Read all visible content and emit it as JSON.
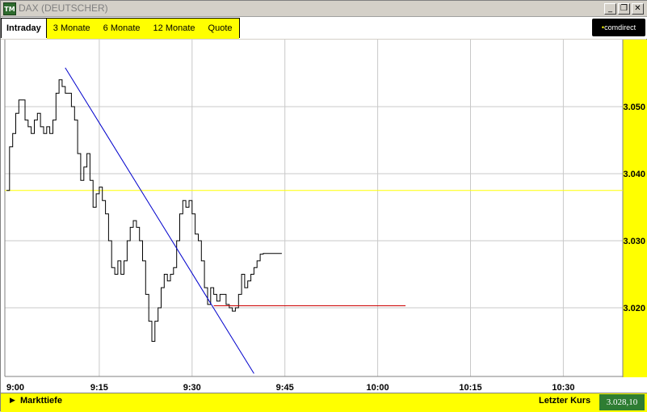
{
  "window": {
    "title": "DAX (DEUTSCHER)",
    "icon_text": "TM",
    "buttons": {
      "minimize": "_",
      "restore": "❐",
      "close": "✕"
    }
  },
  "tabs": [
    {
      "label": "Intraday",
      "active": true
    },
    {
      "label": "3 Monate",
      "active": false
    },
    {
      "label": "6 Monate",
      "active": false
    },
    {
      "label": "12 Monate",
      "active": false
    },
    {
      "label": "Quote",
      "active": false
    }
  ],
  "logo": {
    "dot": "•",
    "text": "comdirect"
  },
  "bottom": {
    "markttiefe_label": "Markttiefe",
    "letzter_kurs_label": "Letzter Kurs",
    "letzter_kurs_value": "3.028,10"
  },
  "colors": {
    "accent": "#ffff00",
    "price_line": "#000000",
    "trend_line": "#0000cc",
    "support_line": "#cc0000",
    "reference_line": "#ffff00",
    "last_price_bg": "#2e7d32"
  },
  "chart_data": {
    "type": "line",
    "x_ticks": [
      "9:00",
      "9:15",
      "9:30",
      "9:45",
      "10:00",
      "10:15",
      "10:30"
    ],
    "y_ticks": [
      "3.020",
      "3.030",
      "3.040",
      "3.050"
    ],
    "x_range_minutes": [
      0,
      99
    ],
    "y_range": [
      3010,
      3061.5
    ],
    "grid": true,
    "series": [
      {
        "x": [
          0,
          0.5,
          1,
          1.5,
          2,
          2.5,
          3,
          3.5,
          4,
          4.5,
          5,
          5.5,
          6,
          6.5,
          7,
          7.5,
          8,
          8.5,
          9,
          9.5,
          10,
          10.5,
          11,
          11.5,
          12,
          12.5,
          13,
          13.5,
          14,
          14.5,
          15,
          15.5,
          16,
          16.5,
          17,
          17.5,
          18,
          18.5,
          19,
          19.5,
          20,
          20.5,
          21,
          21.5,
          22,
          22.5,
          23,
          23.5,
          24,
          24.5,
          25,
          25.5,
          26,
          26.5,
          27,
          27.5,
          28,
          28.5,
          29,
          29.5,
          30,
          30.5,
          31,
          31.5,
          32,
          32.5,
          33,
          33.5,
          34,
          34.5,
          35,
          35.5,
          36,
          36.5,
          37,
          37.5,
          38,
          38.5,
          39,
          39.5,
          40,
          40.5,
          41,
          41.5,
          42,
          42.5,
          43,
          43.5,
          44,
          44.5
        ],
        "y": [
          3037.5,
          3044,
          3046,
          3049,
          3051,
          3051,
          3048,
          3047,
          3046,
          3048,
          3049,
          3047,
          3046,
          3047,
          3046,
          3048,
          3052,
          3054,
          3053,
          3052,
          3052,
          3050,
          3048,
          3043,
          3039,
          3041,
          3043,
          3039,
          3035,
          3037,
          3038,
          3036,
          3034,
          3030,
          3026,
          3025,
          3027,
          3025,
          3027,
          3030,
          3032,
          3033,
          3032,
          3030,
          3027,
          3022,
          3018,
          3015,
          3018,
          3020,
          3023,
          3025,
          3024,
          3025,
          3026,
          3030,
          3034,
          3036,
          3035,
          3036,
          3034,
          3031,
          3030,
          3027,
          3023,
          3020.5,
          3023,
          3022,
          3021,
          3022,
          3022,
          3020.5,
          3020,
          3019.5,
          3020,
          3022,
          3025,
          3023,
          3024,
          3025,
          3026,
          3027,
          3028,
          3028.1,
          3028.1,
          3028.1,
          3028.1,
          3028.1,
          3028.1,
          3028.1
        ]
      }
    ],
    "reference_line_y": 3037.5,
    "support_line": {
      "y": 3020.3,
      "x_from": 33.5,
      "x_to": 64.5
    },
    "trend_line": {
      "x_from": 9.5,
      "y_from": 3055.8,
      "x_to": 40,
      "y_to": 3010.2
    }
  }
}
